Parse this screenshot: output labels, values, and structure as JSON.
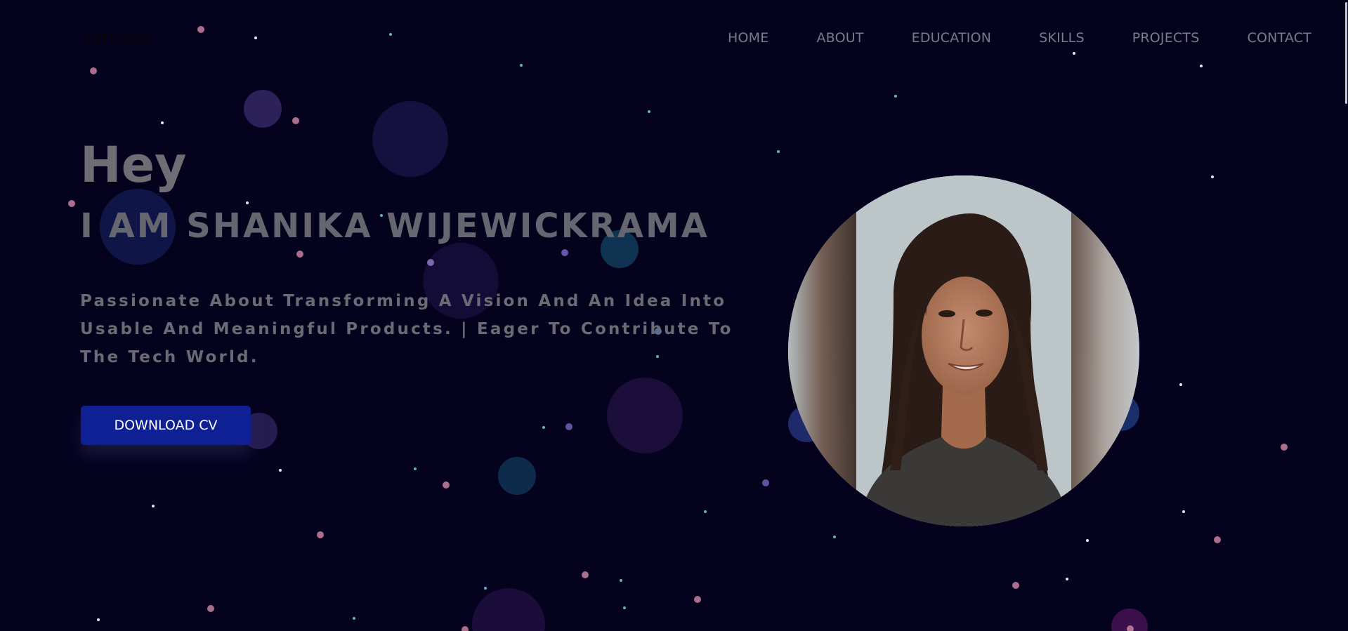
{
  "header": {
    "logo": "Portfolio",
    "nav": [
      "HOME",
      "ABOUT",
      "EDUCATION",
      "SKILLS",
      "PROJECTS",
      "CONTACT"
    ]
  },
  "hero": {
    "greeting": "Hey",
    "name": "I AM SHANIKA WIJEWICKRAMA",
    "tagline": "Passionate About Transforming A Vision And An Idea Into Usable And Meaningful Products. | Eager To Contribute To The Tech World.",
    "cv_button": "DOWNLOAD CV"
  },
  "colors": {
    "background": "#05021e",
    "button": "#0f1f94",
    "nav_text": "#7a7a88",
    "heading_text": "#6d6d73"
  },
  "icons": {
    "profile": "profile-photo"
  }
}
